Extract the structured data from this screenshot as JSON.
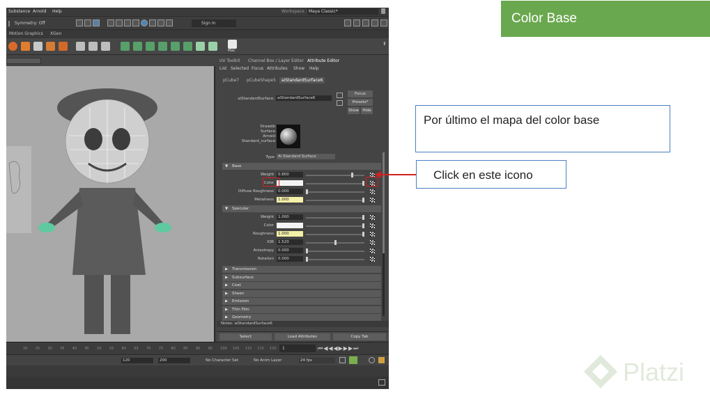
{
  "slide": {
    "title": "Color Base",
    "note": "Por último el mapa del color base",
    "callout": "Click en este icono",
    "watermark": "Platzi",
    "accent_color": "#6aa84f",
    "highlight_color": "#d42020",
    "box_border_color": "#4a7fc1"
  },
  "maya": {
    "menubar": [
      "Substance",
      "Arnold",
      "Help"
    ],
    "workspace_label": "Workspace :",
    "workspace_value": "Maya Classic*",
    "symmetry": "Symmetry: Off",
    "sign_in": "Sign In",
    "shelf_tabs": [
      "Motion Graphics",
      "XGen"
    ],
    "shelf_button": "Mas",
    "panel_tabs": [
      "UV Toolkit",
      "Channel Box / Layer Editor",
      "Attribute Editor"
    ],
    "panel_menu": [
      "List",
      "Selected",
      "Focus",
      "Attributes",
      "Show",
      "Help"
    ],
    "node_tabs": [
      "pCube7",
      "pCubeShape5",
      "aiStandardSurface6"
    ],
    "node_type_label": "aiStandardSurface:",
    "node_name": "aiStandardSurface6",
    "buttons": {
      "focus": "Focus",
      "presets": "Presets*",
      "show": "Show",
      "hide": "Hide"
    },
    "swatch_caption": [
      "Drawdb",
      "Surface",
      "Arnold",
      "Standard_surface"
    ],
    "type_label": "Type",
    "type_value": "Ai Standard Surface",
    "sections": {
      "base": "Base",
      "specular": "Specular",
      "collapsed": [
        "Transmission",
        "Subsurface",
        "Coat",
        "Sheen",
        "Emission",
        "Thin Film",
        "Geometry"
      ]
    },
    "base_attrs": [
      {
        "label": "Weight",
        "value": "0.800",
        "level": 0.8
      },
      {
        "label": "Color",
        "value": "",
        "level": 1.0
      },
      {
        "label": "Diffuse Roughness",
        "value": "0.000",
        "level": 0.0
      },
      {
        "label": "Metalness",
        "value": "1.000",
        "level": 1.0
      }
    ],
    "specular_attrs": [
      {
        "label": "Weight",
        "value": "1.000",
        "level": 1.0
      },
      {
        "label": "Color",
        "value": "",
        "level": 1.0
      },
      {
        "label": "Roughness",
        "value": "1.000",
        "level": 1.0
      },
      {
        "label": "IOR",
        "value": "1.520",
        "level": 0.5
      },
      {
        "label": "Anisotropy",
        "value": "0.000",
        "level": 0.0
      },
      {
        "label": "Rotation",
        "value": "0.000",
        "level": 0.0
      }
    ],
    "notes_label": "Notes: aiStandardSurface6",
    "bottom_buttons": [
      "Select",
      "Load Attributes",
      "Copy Tab"
    ],
    "timeline_ticks": [
      "20",
      "25",
      "30",
      "35",
      "40",
      "45",
      "50",
      "55",
      "60",
      "65",
      "70",
      "75",
      "80",
      "85",
      "90",
      "95",
      "100",
      "105",
      "110",
      "115",
      "120"
    ],
    "current_frame": "1",
    "range_start": "120",
    "range_end": "200",
    "character_set": "No Character Set",
    "anim_layer": "No Anim Layer",
    "fps": "24 fps"
  }
}
